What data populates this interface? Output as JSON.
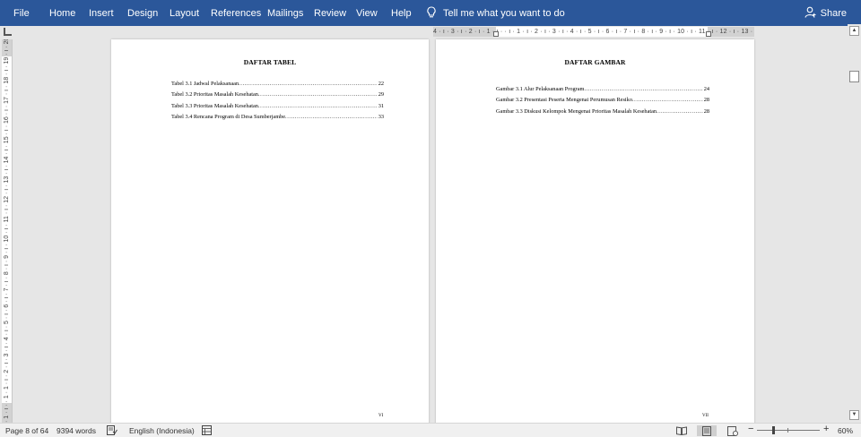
{
  "ribbon": {
    "tabs": [
      "File",
      "Home",
      "Insert",
      "Design",
      "Layout",
      "References",
      "Mailings",
      "Review",
      "View",
      "Help"
    ],
    "tell_me": "Tell me what you want to do",
    "share": "Share",
    "colors": {
      "background": "#2b579a",
      "text": "#ffffff"
    }
  },
  "ruler": {
    "horizontal": "4 · ı · 3 · ı · 2 · ı · 1 · ı ·  · ı · 1 · ı · 2 · ı · 3 · ı · 4 · ı · 5 · ı · 6 · ı · 7 · ı · 8 · ı · 9 · ı · 10 · ı · 11 · ı · 12 · ı · 13 · ı ·  · ı · 15 · ı · 16 · ı",
    "vertical": "· 1 · ı · · 1 · 1 · ı · 2 · ı · 3 · ı · 4 · ı · 5 · ı · 6 · ı · 7 · ı · 8 · ı · 9 · ı · 10 · ı · 11 · ı · 12 · ı · 13 · ı · 14 · ı · 15 · ı · 16 · ı · 17 · ı · 18 · ı · 19 · ı · 20 · ı · 21 · ı · 22 · ı · 23 · ı 24"
  },
  "pages": {
    "left": {
      "title": "DAFTAR TABEL",
      "entries": [
        {
          "text": "Tabel 3.1 Jadwal Pelaksanaan",
          "page": "22"
        },
        {
          "text": "Tabel 3.2 Prioritas Masalah Kesehatan",
          "page": "29"
        },
        {
          "text": "Tabel 3.3 Prioritas Masalah Kesehatan",
          "page": "31"
        },
        {
          "text": "Tabel 3.4 Rencana Program di Desa Sumberjambe",
          "page": "33"
        }
      ],
      "page_number": "VI"
    },
    "right": {
      "title": "DAFTAR GAMBAR",
      "entries": [
        {
          "text": "Gambar 3.1 Alur Pelaksanaan Program",
          "page": "24"
        },
        {
          "text": "Gambar 3.2 Presentasi Peserta Mengenai Perumusan Resiko",
          "page": "28"
        },
        {
          "text": "Gambar 3.3 Diskusi Kelompok Mengenai Prioritas Masalah Kesehatan",
          "page": "28"
        }
      ],
      "page_number": "VII"
    }
  },
  "status": {
    "page": "Page 8 of 64",
    "words": "9394 words",
    "language": "English (Indonesia)",
    "zoom": "60%",
    "zoom_minus": "−",
    "zoom_plus": "+"
  }
}
